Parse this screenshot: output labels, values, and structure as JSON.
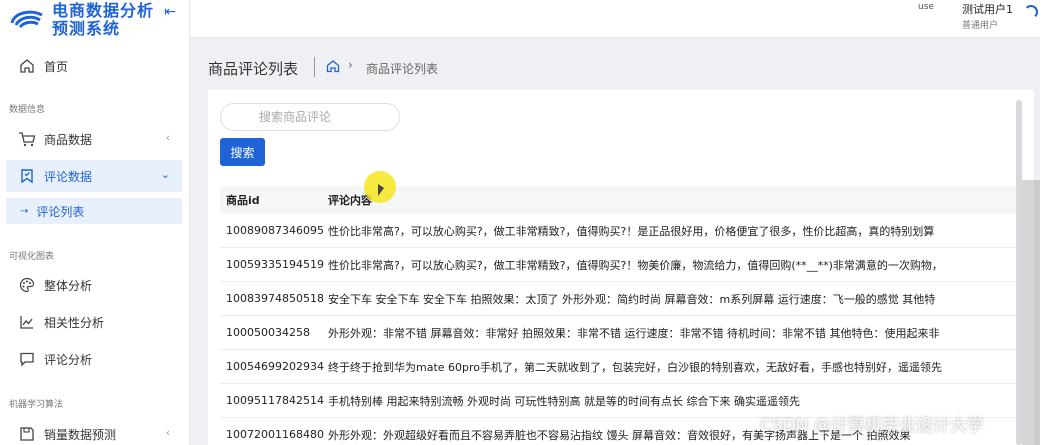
{
  "app": {
    "title_line1": "电商数据分析",
    "title_line2": "预测系统"
  },
  "sidebar": {
    "home": "首页",
    "section_data": "数据信息",
    "goods_data": "商品数据",
    "comment_data": "评论数据",
    "comment_list": "评论列表",
    "section_vis": "可视化图表",
    "overall": "整体分析",
    "correlation": "相关性分析",
    "comment_analysis": "评论分析",
    "section_ml": "机器学习算法",
    "sales_predict": "销量数据预测"
  },
  "header": {
    "avatar_alt": "use",
    "user_name": "测试用户1",
    "user_role": "普通用户"
  },
  "page": {
    "title": "商品评论列表",
    "breadcrumb": "商品评论列表"
  },
  "search": {
    "placeholder": "搜索商品评论",
    "button": "搜索"
  },
  "table": {
    "headers": [
      "商品id",
      "评论内容"
    ],
    "rows": [
      {
        "id": "10089087346095",
        "text": "性价比非常高?，可以放心购买?，做工非常精致?，值得购买?！是正品很好用，价格便宜了很多，性价比超高，真的特别划算"
      },
      {
        "id": "10059335194519",
        "text": "性价比非常高?，可以放心购买?，做工非常精致?，值得购买?！物美价廉，物流给力，值得回购(**__**)非常满意的一次购物，"
      },
      {
        "id": "10083974850518",
        "text": "安全下车 安全下车 安全下车 拍照效果：太顶了 外形外观：简约时尚 屏幕音效：m系列屏幕 运行速度：飞一般的感觉 其他特"
      },
      {
        "id": "100050034258",
        "text": "外形外观：非常不错 屏幕音效：非常好 拍照效果：非常不错 运行速度：非常不错 待机时间：非常不错 其他特色：使用起来非"
      },
      {
        "id": "10054699202934",
        "text": "终于终于抢到华为mate 60pro手机了，第二天就收到了，包装完好，白沙银的特别喜欢，无敌好看，手感也特别好，遥遥领先"
      },
      {
        "id": "10095117842514",
        "text": "手机特别棒 用起来特别流畅 外观时尚 可玩性特别高 就是等的时间有点长 综合下来 确实遥遥领先"
      },
      {
        "id": "10072001168480",
        "text": "外形外观：外观超级好看而且不容易弄脏也不容易沾指纹 馒头 屏幕音效：音效很好，有美字扬声器上下是一个 拍照效果"
      }
    ]
  },
  "watermark": "CSDN @计算机毕业设计大学",
  "colors": {
    "primary": "#1e64d8",
    "active_bg": "#e8f0fe"
  }
}
